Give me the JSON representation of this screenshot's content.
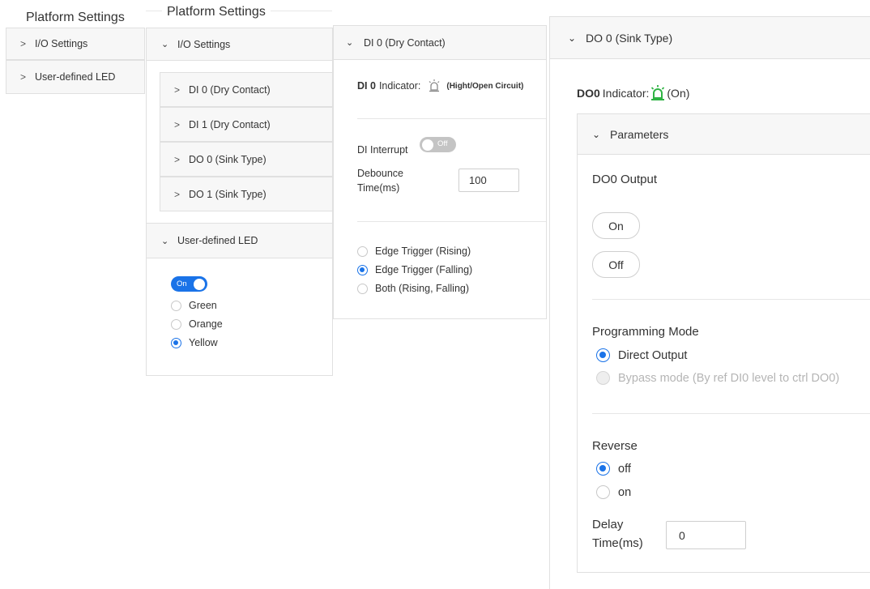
{
  "col1": {
    "title": "Platform Settings",
    "items": [
      "I/O Settings",
      "User-defined LED"
    ]
  },
  "col2": {
    "title": "Platform Settings",
    "io_header": "I/O Settings",
    "io_items": [
      "DI 0 (Dry Contact)",
      "DI 1 (Dry Contact)",
      "DO 0 (Sink Type)",
      "DO 1 (Sink Type)"
    ],
    "led_header": "User-defined LED",
    "led_toggle": "On",
    "led_colors": [
      "Green",
      "Orange",
      "Yellow"
    ],
    "led_selected": "Yellow"
  },
  "col3": {
    "header": "DI 0 (Dry Contact)",
    "indicator_label_bold": "DI 0",
    "indicator_label": "Indicator:",
    "indicator_state": "(Hight/Open Circuit)",
    "interrupt_label": "DI Interrupt",
    "interrupt_toggle": "Off",
    "debounce_label_line1": "Debounce",
    "debounce_label_line2": "Time(ms)",
    "debounce_value": "100",
    "triggers": [
      "Edge Trigger (Rising)",
      "Edge Trigger (Falling)",
      "Both (Rising, Falling)"
    ],
    "trigger_selected": "Edge Trigger (Falling)"
  },
  "col4": {
    "header": "DO 0 (Sink Type)",
    "indicator_label_bold": "DO0",
    "indicator_label": "Indicator:",
    "indicator_state": "(On)",
    "params_header": "Parameters",
    "output_label": "DO0 Output",
    "on_button": "On",
    "off_button": "Off",
    "mode_label": "Programming Mode",
    "modes": [
      "Direct Output",
      "Bypass mode (By ref DI0 level to ctrl DO0)"
    ],
    "mode_selected": "Direct Output",
    "reverse_label": "Reverse",
    "reverse_options": [
      "off",
      "on"
    ],
    "reverse_selected": "off",
    "delay_label_line1": "Delay",
    "delay_label_line2": "Time(ms)",
    "delay_value": "0"
  },
  "colors": {
    "accent": "#1a73e8",
    "indicator_on": "#2fb344",
    "indicator_off": "#888888",
    "toggle_off": "#c4c4c4"
  }
}
